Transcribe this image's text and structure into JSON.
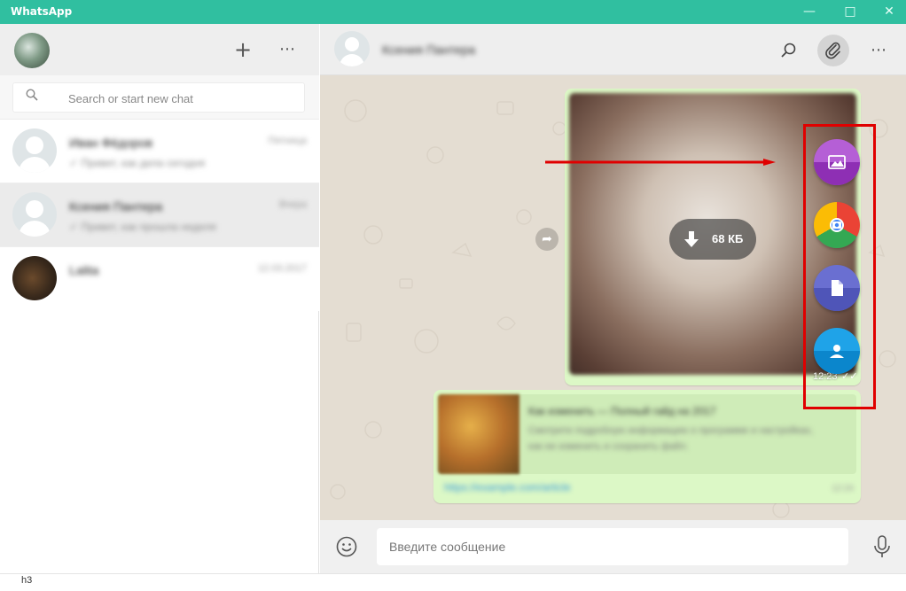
{
  "window": {
    "title": "WhatsApp",
    "minimize_icon": "minimize-icon",
    "maximize_icon": "maximize-icon",
    "close_icon": "close-icon",
    "accent": "#30bfa0"
  },
  "sidebar": {
    "new_chat_icon": "plus-icon",
    "menu_icon": "more-icon",
    "search": {
      "placeholder": "Search or start new chat",
      "icon": "search-icon"
    },
    "chats": [
      {
        "name": "Иван Фёдоров",
        "preview": "✓ Привет, как дела сегодня",
        "time": "Пятница",
        "active": false
      },
      {
        "name": "Ксения Пантера",
        "preview": "✓ Привет, как прошла неделя",
        "time": "Вчера",
        "active": true
      },
      {
        "name": "Lalita",
        "preview": "",
        "time": "12.03.2017",
        "active": false
      }
    ]
  },
  "chat": {
    "contact_name": "Ксения Пантера",
    "header_icons": [
      "search-icon",
      "attach-icon",
      "more-icon"
    ],
    "image_message": {
      "download_size": "68 КБ",
      "time": "12:23",
      "status": "read"
    },
    "link_message": {
      "title": "Как изменить — Полный гайд на 2017",
      "description": "Смотрите подробную информацию о программе и настройках, как ее изменить и сохранить файл.",
      "url": "https://example.com/article",
      "time": "12:24"
    },
    "attach_menu": [
      {
        "name": "gallery",
        "icon": "image-icon",
        "color_top": "#b55fd6",
        "color_bottom": "#8e2fb4"
      },
      {
        "name": "camera",
        "icon": "camera-icon",
        "color_top": "#ea4335",
        "color_bottom": "#4285f4"
      },
      {
        "name": "document",
        "icon": "document-icon",
        "color_top": "#6a6fd1",
        "color_bottom": "#4f55b8"
      },
      {
        "name": "contact",
        "icon": "contact-icon",
        "color_top": "#1fa3e8",
        "color_bottom": "#0b86cc"
      }
    ],
    "highlight_color": "#e00000"
  },
  "composer": {
    "placeholder": "Введите сообщение",
    "emoji_icon": "emoji-icon",
    "mic_icon": "microphone-icon"
  },
  "statusbar": {
    "text": "h3"
  }
}
